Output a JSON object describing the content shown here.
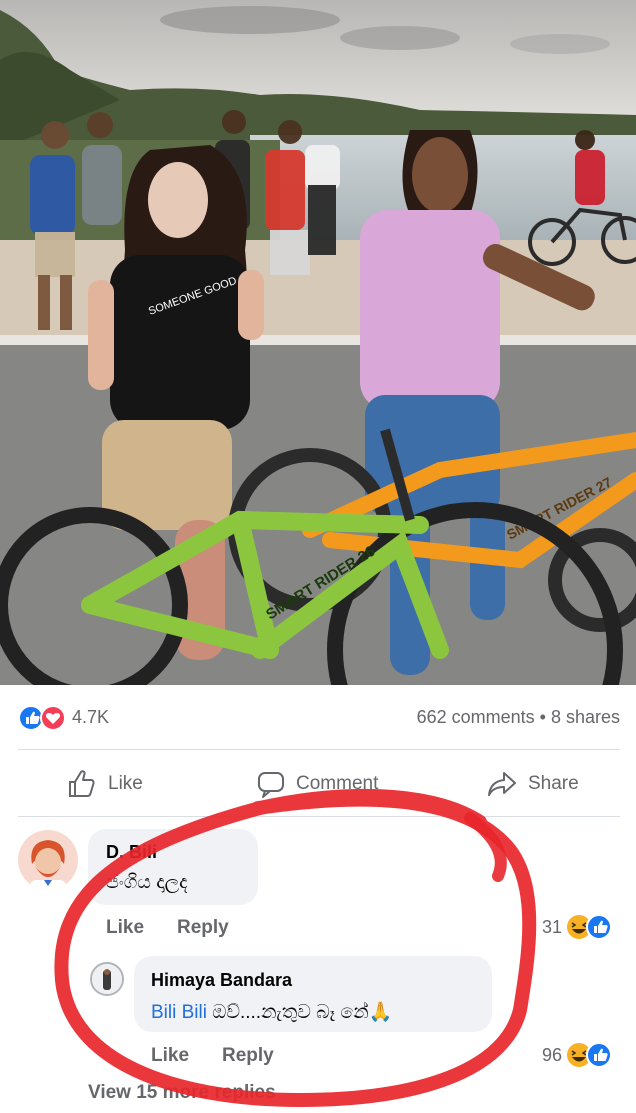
{
  "post": {
    "photo_icon": "beach-promenade-photo",
    "reactions": {
      "icons": [
        "like-reaction-icon",
        "love-reaction-icon"
      ],
      "count": "4.7K"
    },
    "stats": "662 comments • 8 shares"
  },
  "actions": {
    "like": "Like",
    "comment": "Comment",
    "share": "Share"
  },
  "comments": [
    {
      "author": "D. Bili",
      "text": "ජංගිය දාලද",
      "like": "Like",
      "reply": "Reply",
      "reaction_count": "31",
      "reaction_icons": [
        "haha-reaction-icon",
        "like-reaction-icon"
      ]
    }
  ],
  "reply": {
    "author": "Himaya Bandara",
    "mention": "Bili Bili",
    "text": "ඔව්....නැතුව බෑ නේ🙏",
    "like": "Like",
    "reply": "Reply",
    "reaction_count": "96",
    "reaction_icons": [
      "haha-reaction-icon",
      "like-reaction-icon"
    ]
  },
  "view_more": "View 15 more replies",
  "colors": {
    "accent": "#1877f2",
    "love": "#f33e58",
    "haha": "#f7b125",
    "marker": "#e8262b"
  }
}
